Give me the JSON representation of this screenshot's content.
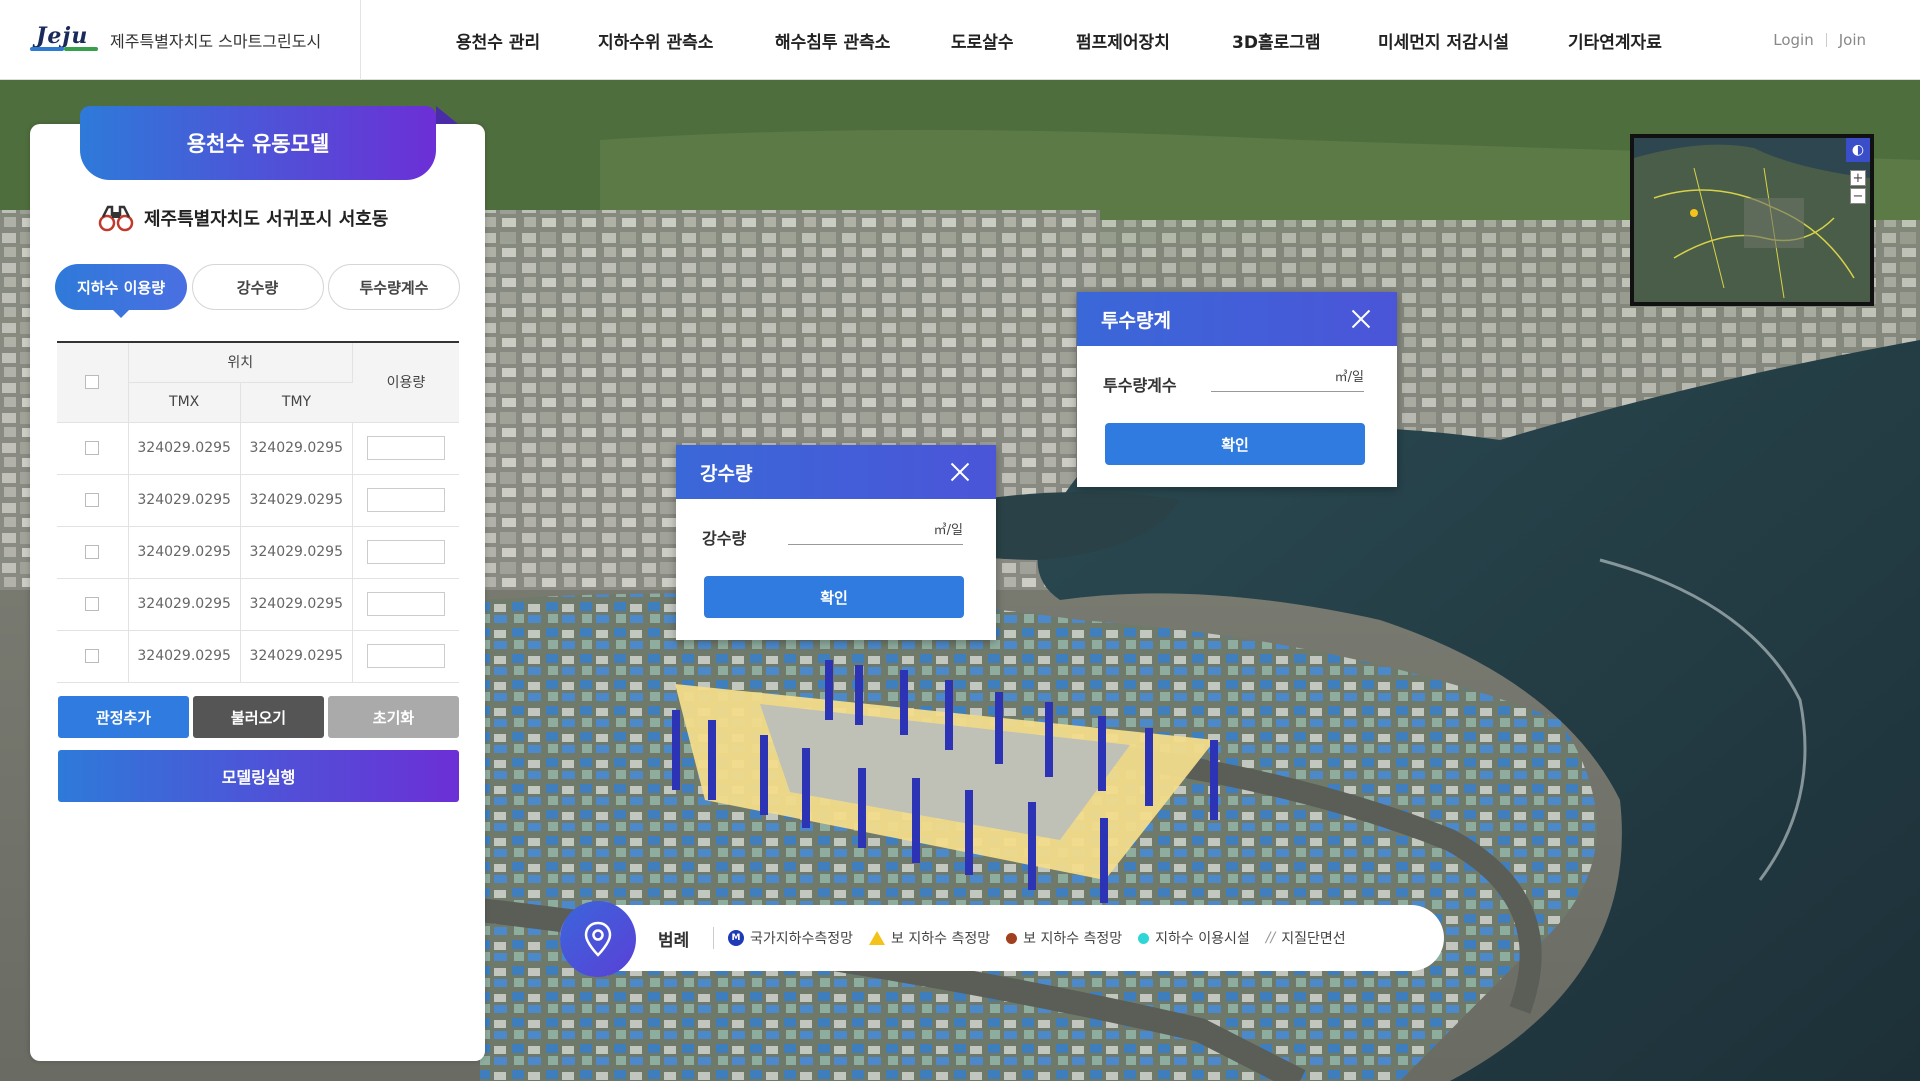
{
  "header": {
    "logo_mark": "Jeju",
    "logo_text": "제주특별자치도 스마트그린도시",
    "nav": [
      "용천수 관리",
      "지하수위 관측소",
      "해수침투 관측소",
      "도로살수",
      "펌프제어장치",
      "3D홀로그램",
      "미세먼지 저감시설",
      "기타연계자료"
    ],
    "login": "Login",
    "join": "Join"
  },
  "panel": {
    "title": "용천수 유동모델",
    "location": "제주특별자치도 서귀포시 서호동",
    "tabs": [
      "지하수 이용량",
      "강수량",
      "투수량계수"
    ],
    "active_tab": 0,
    "table": {
      "col_position": "위치",
      "col_tmx": "TMX",
      "col_tmy": "TMY",
      "col_usage": "이용량",
      "rows": [
        {
          "tmx": "324029.0295",
          "tmy": "324029.0295",
          "usage": ""
        },
        {
          "tmx": "324029.0295",
          "tmy": "324029.0295",
          "usage": ""
        },
        {
          "tmx": "324029.0295",
          "tmy": "324029.0295",
          "usage": ""
        },
        {
          "tmx": "324029.0295",
          "tmy": "324029.0295",
          "usage": ""
        },
        {
          "tmx": "324029.0295",
          "tmy": "324029.0295",
          "usage": ""
        }
      ]
    },
    "buttons": {
      "add": "관정추가",
      "load": "불러오기",
      "reset": "초기화",
      "run": "모델링실행"
    }
  },
  "popup_rain": {
    "title": "강수량",
    "field_label": "강수량",
    "unit": "㎥/일",
    "confirm": "확인"
  },
  "popup_perm": {
    "title": "투수량계",
    "field_label": "투수량계수",
    "unit": "㎥/일",
    "confirm": "확인"
  },
  "legend": {
    "label": "범례",
    "items": [
      {
        "icon": "m-badge-icon",
        "text": "국가지하수측정망",
        "color": "#1e3bb5"
      },
      {
        "icon": "triangle-icon",
        "text": "보 지하수 측정망",
        "color": "#f3c21b"
      },
      {
        "icon": "dot-icon",
        "text": "보 지하수 측정망",
        "color": "#a0401e"
      },
      {
        "icon": "dot-icon",
        "text": "지하수 이용시설",
        "color": "#2fd6d6"
      },
      {
        "icon": "slash-icon",
        "text": "지질단면선",
        "color": "#999999"
      }
    ]
  },
  "minimap": {
    "zoom_in": "+",
    "zoom_out": "−",
    "globe_icon": "globe-icon"
  },
  "colors": {
    "primary_blue": "#2f7be0",
    "gradient_start": "#2e7ad9",
    "gradient_end": "#6c2fd6",
    "popup_header": "#3a68d8"
  }
}
